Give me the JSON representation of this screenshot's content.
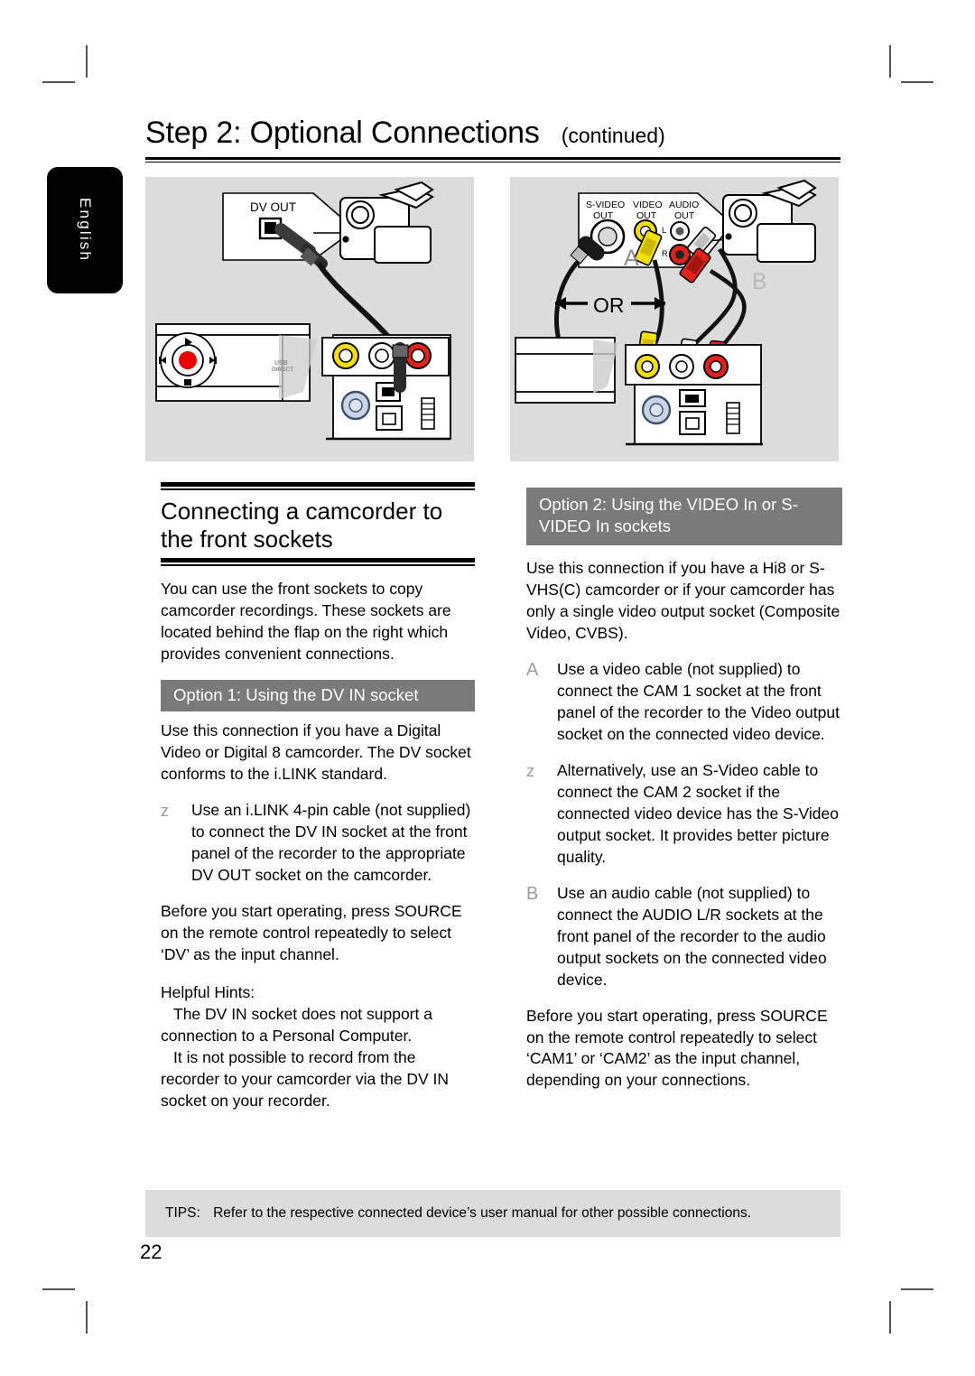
{
  "meta": {
    "page_number": "22",
    "language_tab": "English"
  },
  "header": {
    "title": "Step 2: Optional Connections",
    "continued": "(continued)"
  },
  "figures": {
    "left": {
      "name": "dv-in-connection-diagram",
      "labels": {
        "dv_out": "DV OUT"
      }
    },
    "right": {
      "name": "video-svideo-connection-diagram",
      "labels": {
        "svideo_out_line1": "S-VIDEO",
        "svideo_out_line2": "OUT",
        "video_out_line1": "VIDEO",
        "video_out_line2": "OUT",
        "audio_out_line1": "AUDIO",
        "audio_out_line2": "OUT",
        "channel_left": "L",
        "channel_right": "R",
        "marker_a": "A",
        "marker_b": "B",
        "or": "OR"
      }
    }
  },
  "left_column": {
    "section_title": "Connecting a camcorder to the front sockets",
    "intro": "You can use the front sockets to copy camcorder recordings. These sockets are located behind the flap on the right which provides convenient connections.",
    "option_bar": "Option 1: Using the DV IN socket",
    "option_intro": "Use this connection if you have a Digital Video or Digital 8 camcorder. The DV socket conforms to the i.LINK standard.",
    "items": [
      {
        "marker": "z",
        "text": "Use an i.LINK 4-pin cable (not supplied) to connect the DV IN  socket at the front panel of the recorder to the appropriate DV OUT socket on the camcorder."
      }
    ],
    "source_note": "Before you start operating, press SOURCE on the remote control repeatedly to select ‘DV’ as the input channel.",
    "hints": {
      "heading": "Helpful Hints:",
      "lines": [
        "The DV IN socket does not support a connection to a Personal Computer.",
        "It is not possible to record from the recorder to your camcorder via the DV IN socket on your recorder."
      ]
    }
  },
  "right_column": {
    "option_bar": "Option 2: Using the VIDEO In or S-VIDEO In sockets",
    "option_intro": "Use this connection if you have a Hi8 or S-VHS(C) camcorder or if your camcorder has only a single video output socket (Composite Video, CVBS).",
    "items": [
      {
        "marker": "A",
        "text": "Use a video cable (not supplied) to connect the CAM 1  socket at the front panel of the recorder to the Video output socket on the connected video device."
      },
      {
        "marker": "z",
        "text": "Alternatively, use an S-Video cable to connect the CAM 2  socket if the connected video device has the S-Video output socket.  It provides better picture quality."
      },
      {
        "marker": "B",
        "text": "Use an audio cable (not supplied) to connect the AUDIO L/R  sockets at the front panel of the recorder to the audio output sockets on the connected video device."
      }
    ],
    "source_note": "Before you start operating, press SOURCE on the remote control repeatedly to select ‘CAM1’ or ‘CAM2’ as the input channel, depending on your connections."
  },
  "footer": {
    "tips_label": "TIPS:",
    "tips_text": "Refer to the respective connected device’s user manual for other possible connections."
  },
  "colors": {
    "figure_background": "#dcdcdc",
    "option_bar_background": "#7a7a7a",
    "marker_grey": "#9a9a9a",
    "tips_background": "#dcdcdc",
    "yellow_connector": "#f5e000",
    "red_connector": "#e32119",
    "record_red": "#ee0000"
  }
}
